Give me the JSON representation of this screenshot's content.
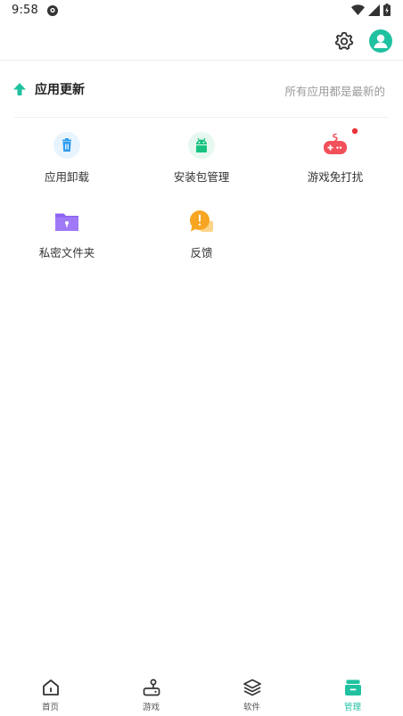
{
  "status_bar": {
    "time": "9:58"
  },
  "update": {
    "title": "应用更新",
    "status": "所有应用都是最新的"
  },
  "tools": [
    {
      "label": "应用卸载",
      "icon": "trash-icon"
    },
    {
      "label": "安装包管理",
      "icon": "android-icon"
    },
    {
      "label": "游戏免打扰",
      "icon": "gamepad-icon"
    },
    {
      "label": "私密文件夹",
      "icon": "lock-folder-icon"
    },
    {
      "label": "反馈",
      "icon": "feedback-icon"
    }
  ],
  "nav": [
    {
      "label": "首页",
      "icon": "home-icon"
    },
    {
      "label": "游戏",
      "icon": "joystick-icon"
    },
    {
      "label": "软件",
      "icon": "layers-icon"
    },
    {
      "label": "管理",
      "icon": "manage-icon",
      "active": true
    }
  ],
  "colors": {
    "accent": "#1fc1a0",
    "badge": "#e8323a",
    "trash": "#2f9bf0",
    "android": "#18c280",
    "game": "#f2505a",
    "folder": "#8d63f2",
    "feedback": "#f7a623"
  }
}
